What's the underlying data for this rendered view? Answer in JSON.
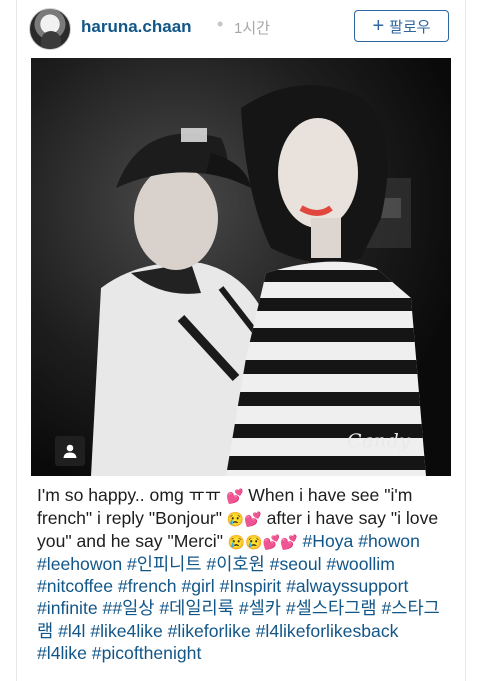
{
  "header": {
    "username": "haruna.chaan",
    "separator": "•",
    "time": "1시간",
    "follow_plus": "+",
    "follow_label": "팔로우"
  },
  "photo": {
    "watermark": "Candy",
    "user_tag_icon": "person-icon"
  },
  "caption": {
    "text_1": "I'm so happy.. omg ㅠㅠ ",
    "emoji_1": "💕",
    "text_2": " When i have see \"i'm french\" i reply \"Bonjour\" ",
    "emoji_2": "😢💕",
    "text_3": " after i have say \"i love you\" and he say \"Merci\" ",
    "emoji_3": "😢😢💕💕",
    "hashtags_line1": [
      "#Hoya"
    ],
    "hashtags": [
      "#howon",
      "#leehowon",
      "#인피니트",
      "#이호원",
      "#seoul",
      "#woollim",
      "#nitcoffee",
      "#french",
      "#girl",
      "#Inspirit",
      "#alwayssupport",
      "#infinite",
      "##일상",
      "#데일리룩",
      "#셀카",
      "#셀스타그램",
      "#스타그램",
      "#l4l",
      "#like4like",
      "#likeforlike",
      "#l4likeforlikesback",
      "#l4like",
      "#picofthenight"
    ]
  },
  "colors": {
    "link": "#125688",
    "follow_border": "#2f66a0",
    "text": "#1d1d1d",
    "muted": "#a5a7aa"
  }
}
